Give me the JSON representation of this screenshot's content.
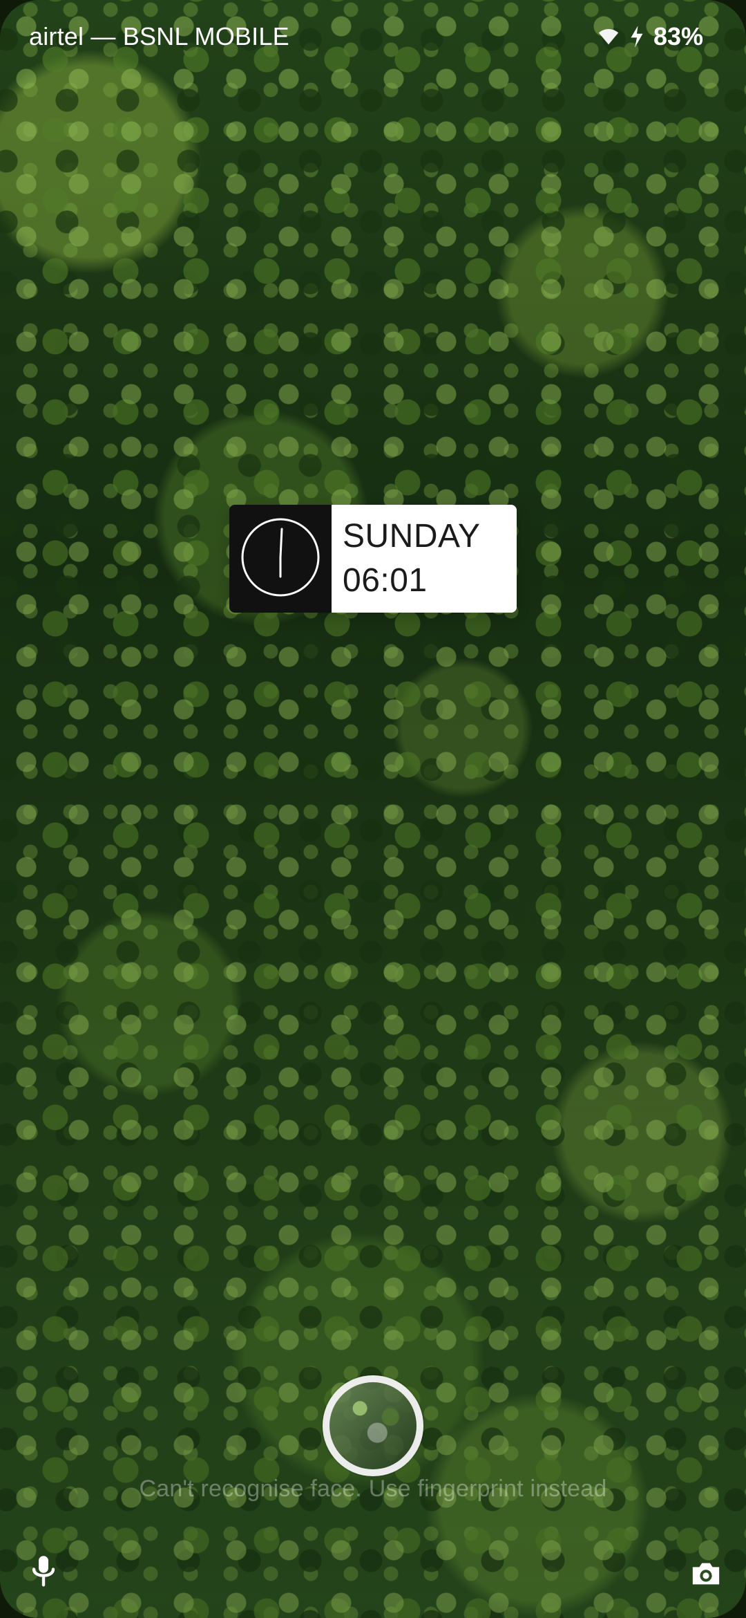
{
  "status_bar": {
    "carrier": "airtel — BSNL MOBILE",
    "battery": "83%"
  },
  "lock_widget": {
    "day": "SUNDAY",
    "time": "06:01"
  },
  "lock_screen": {
    "face_message": "Can't recognise face. Use fingerprint instead"
  },
  "icons": {
    "wifi": "wifi-icon",
    "charging": "charging-icon",
    "clock": "analog-clock-icon",
    "mic": "mic-icon",
    "camera": "camera-icon"
  },
  "colors": {
    "wallpaper_primary": "#24461a",
    "widget_dark": "#111111",
    "widget_light": "#ffffff",
    "text_white": "#ffffff"
  }
}
